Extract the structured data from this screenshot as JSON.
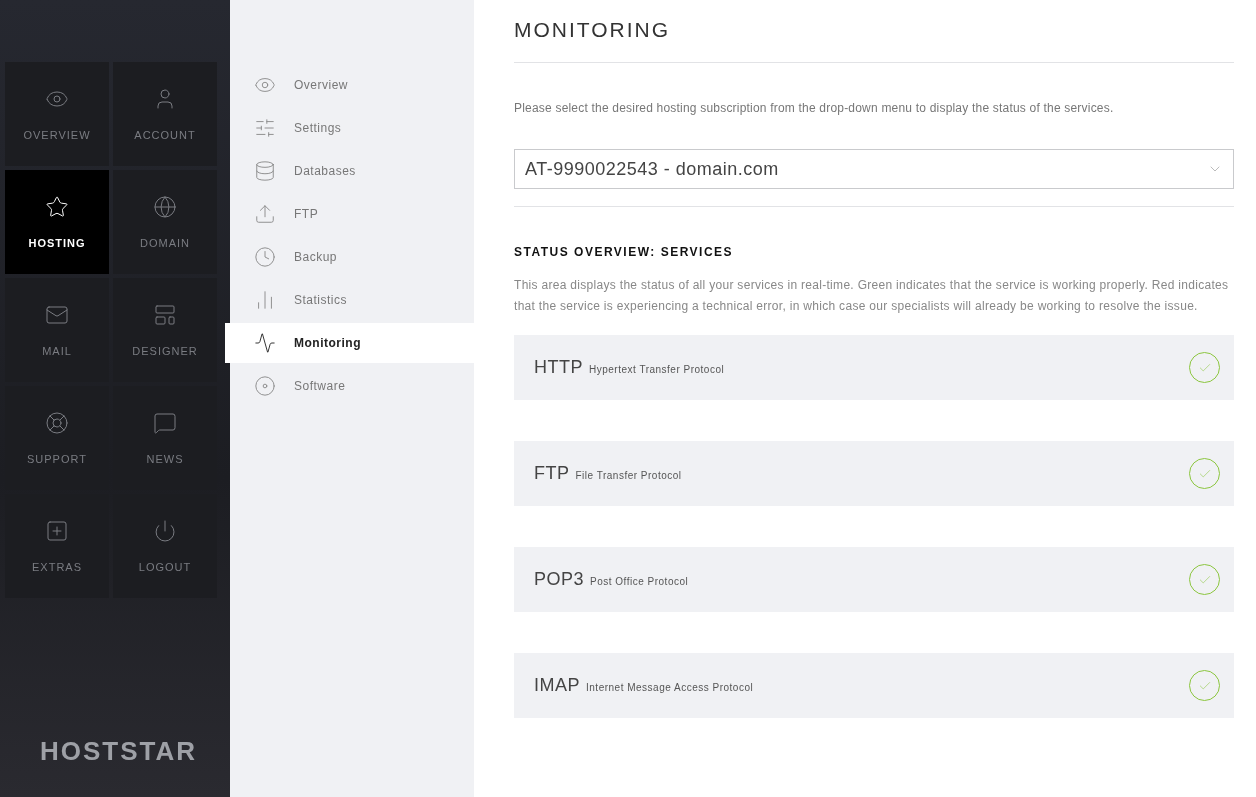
{
  "main_nav": [
    {
      "label": "OVERVIEW",
      "selected": false
    },
    {
      "label": "ACCOUNT",
      "selected": false
    },
    {
      "label": "HOSTING",
      "selected": true
    },
    {
      "label": "DOMAIN",
      "selected": false
    },
    {
      "label": "MAIL",
      "selected": false
    },
    {
      "label": "DESIGNER",
      "selected": false
    },
    {
      "label": "SUPPORT",
      "selected": false
    },
    {
      "label": "NEWS",
      "selected": false
    },
    {
      "label": "EXTRAS",
      "selected": false
    },
    {
      "label": "LOGOUT",
      "selected": false
    }
  ],
  "logo": "HOSTSTAR",
  "sub_nav": [
    {
      "label": "Overview",
      "selected": false
    },
    {
      "label": "Settings",
      "selected": false
    },
    {
      "label": "Databases",
      "selected": false
    },
    {
      "label": "FTP",
      "selected": false
    },
    {
      "label": "Backup",
      "selected": false
    },
    {
      "label": "Statistics",
      "selected": false
    },
    {
      "label": "Monitoring",
      "selected": true
    },
    {
      "label": "Software",
      "selected": false
    }
  ],
  "page_title": "MONITORING",
  "intro": "Please select the desired hosting subscription from the drop-down menu to display the status of the services.",
  "subscription_select": {
    "value": "AT-9990022543 - domain.com"
  },
  "section_title": "STATUS OVERVIEW: SERVICES",
  "section_text": "This area displays the status of all your services in real-time. Green indicates that the service is working properly. Red indicates that the service is experiencing a technical error, in which case our specialists will already be working to resolve the issue.",
  "services": [
    {
      "name": "HTTP",
      "description": "Hypertext Transfer Protocol",
      "working": true
    },
    {
      "name": "FTP",
      "description": "File Transfer Protocol",
      "working": true
    },
    {
      "name": "POP3",
      "description": "Post Office Protocol",
      "working": true
    },
    {
      "name": "IMAP",
      "description": "Internet Message Access Protocol",
      "working": true
    }
  ]
}
